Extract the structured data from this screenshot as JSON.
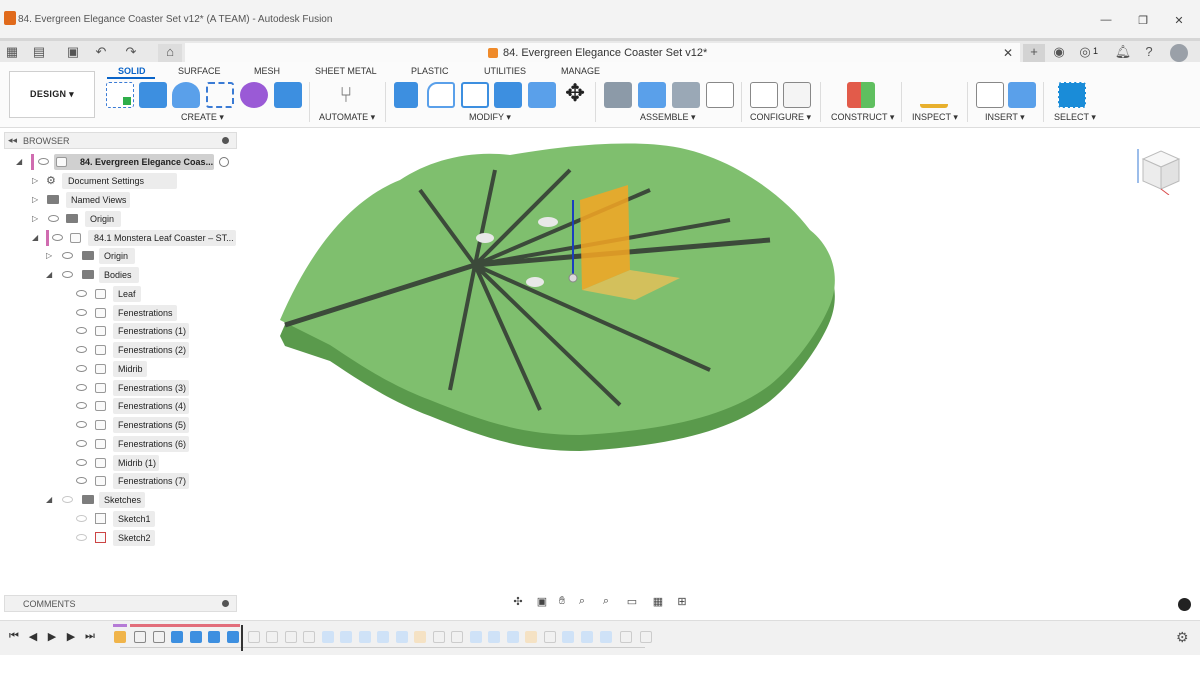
{
  "window": {
    "title": "84. Evergreen Elegance Coaster Set v12* (A TEAM) - Autodesk Fusion",
    "min": "—",
    "max": "❐",
    "close": "✕"
  },
  "doc_tab": {
    "name": "84. Evergreen Elegance Coaster Set v12*",
    "close": "✕"
  },
  "header_badge": {
    "jobs_count": "1"
  },
  "ribbon": {
    "workspace": "DESIGN ▾",
    "tabs": [
      "SOLID",
      "SURFACE",
      "MESH",
      "SHEET METAL",
      "PLASTIC",
      "UTILITIES",
      "MANAGE"
    ],
    "groups": [
      "CREATE ▾",
      "AUTOMATE ▾",
      "MODIFY ▾",
      "ASSEMBLE ▾",
      "CONFIGURE ▾",
      "CONSTRUCT ▾",
      "INSPECT ▾",
      "INSERT ▾",
      "SELECT ▾"
    ]
  },
  "browser": {
    "header": "BROWSER",
    "root": "84. Evergreen Elegance Coas...",
    "document_settings": "Document Settings",
    "named_views": "Named Views",
    "origin": "Origin",
    "component": "84.1 Monstera Leaf Coaster – ST...",
    "comp_origin": "Origin",
    "bodies": "Bodies",
    "body_items": [
      "Leaf",
      "Fenestrations",
      "Fenestrations  (1)",
      "Fenestrations  (2)",
      "Midrib",
      "Fenestrations  (3)",
      "Fenestrations  (4)",
      "Fenestrations  (5)",
      "Fenestrations  (6)",
      "Midrib (1)",
      "Fenestrations  (7)"
    ],
    "sketches": "Sketches",
    "sketch_items": [
      "Sketch1",
      "Sketch2"
    ]
  },
  "comments": {
    "header": "COMMENTS"
  },
  "colors": {
    "accent": "#0a64c8",
    "leaf": "#7fbf6e",
    "leaf_side": "#5a9a4c",
    "highlight": "#f5a623"
  }
}
